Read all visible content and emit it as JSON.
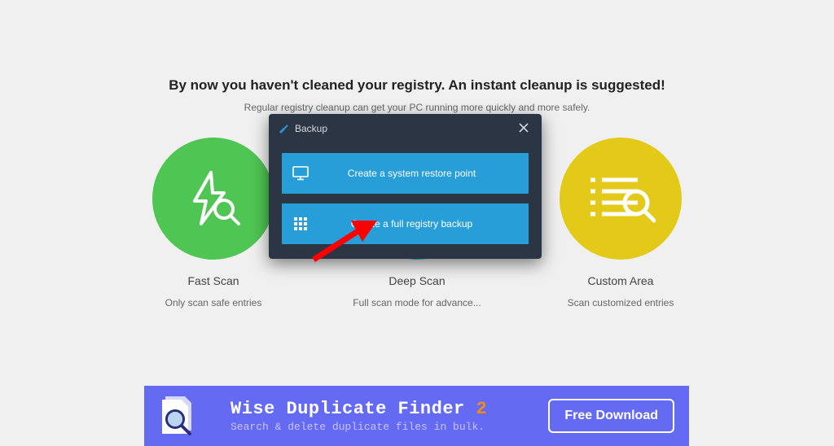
{
  "heading": "By now you haven't cleaned your registry. An instant cleanup is suggested!",
  "subheading": "Regular registry cleanup can get your PC running more quickly and more safely.",
  "scan": {
    "fast": {
      "title": "Fast Scan",
      "desc": "Only scan safe entries"
    },
    "deep": {
      "title": "Deep Scan",
      "desc": "Full scan mode for advance..."
    },
    "custom": {
      "title": "Custom Area",
      "desc": "Scan customized entries"
    }
  },
  "modal": {
    "title": "Backup",
    "restore_label": "Create a system restore point",
    "backup_label": "Create a full registry backup"
  },
  "banner": {
    "title_prefix": "Wise Duplicate Finder ",
    "title_suffix": "2",
    "subtitle": "Search & delete duplicate files in bulk.",
    "button_label": "Free Download"
  }
}
